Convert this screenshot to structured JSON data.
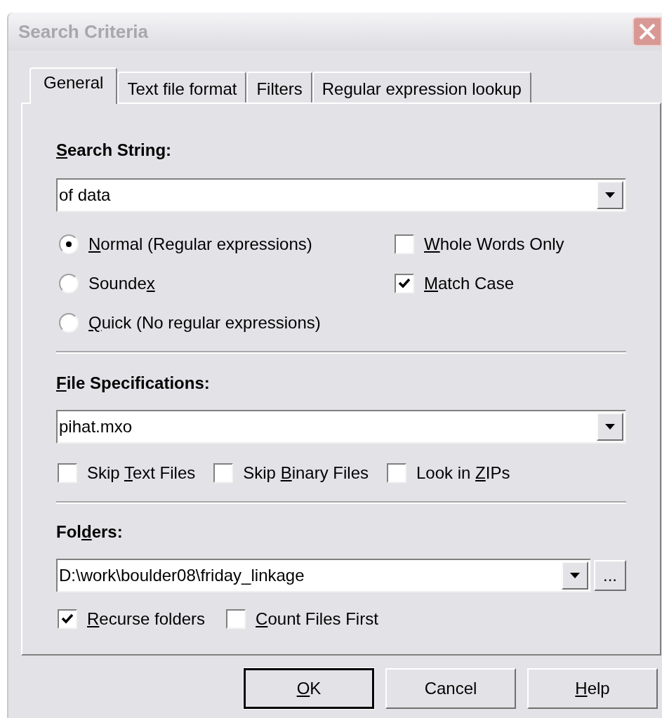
{
  "window": {
    "title": "Search Criteria"
  },
  "tabs": [
    {
      "label": "General",
      "selected": true
    },
    {
      "label": "Text file format",
      "selected": false
    },
    {
      "label": "Filters",
      "selected": false
    },
    {
      "label": "Regular expression lookup",
      "selected": false
    }
  ],
  "search_string": {
    "label": {
      "key": "S",
      "after": "earch String:"
    },
    "value": "of data"
  },
  "match_mode": [
    {
      "label": {
        "key": "N",
        "after": "ormal (Regular expressions)"
      },
      "selected": true
    },
    {
      "label": {
        "before": "Sounde",
        "key": "x"
      },
      "selected": false
    },
    {
      "label": {
        "key": "Q",
        "after": "uick (No regular expressions)"
      },
      "selected": false
    }
  ],
  "search_options": [
    {
      "label": {
        "key": "W",
        "after": "hole Words Only"
      },
      "checked": false
    },
    {
      "label": {
        "key": "M",
        "after": "atch Case"
      },
      "checked": true
    }
  ],
  "file_specifications": {
    "label": {
      "key": "F",
      "after": "ile Specifications:"
    },
    "value": "pihat.mxo"
  },
  "file_options": [
    {
      "label": {
        "before": "Skip ",
        "key": "T",
        "after": "ext Files"
      },
      "checked": false
    },
    {
      "label": {
        "before": "Skip ",
        "key": "B",
        "after": "inary Files"
      },
      "checked": false
    },
    {
      "label": {
        "before": "Look in ",
        "key": "Z",
        "after": "IPs"
      },
      "checked": false
    }
  ],
  "folders": {
    "label": {
      "before": "Fol",
      "key": "d",
      "after": "ers:"
    },
    "value": "D:\\work\\boulder08\\friday_linkage",
    "browse": "..."
  },
  "folder_options": [
    {
      "label": {
        "key": "R",
        "after": "ecurse folders"
      },
      "checked": true
    },
    {
      "label": {
        "key": "C",
        "after": "ount Files First"
      },
      "checked": false
    }
  ],
  "buttons": [
    {
      "label": {
        "key": "O",
        "after": "K"
      },
      "default": true
    },
    {
      "label": {
        "before": "Cancel"
      },
      "default": false
    },
    {
      "label": {
        "key": "H",
        "after": "elp"
      },
      "default": false
    }
  ]
}
